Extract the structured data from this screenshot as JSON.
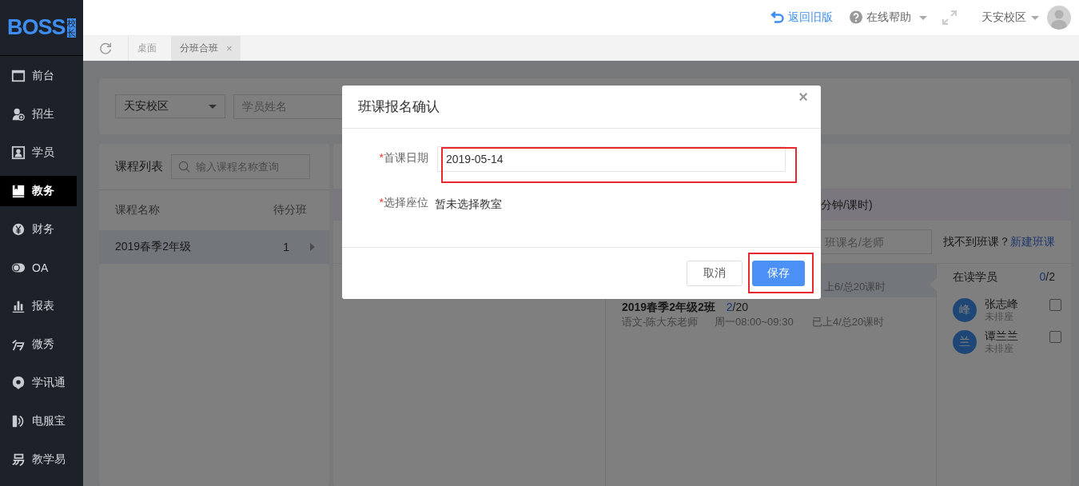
{
  "sidebar": {
    "logo": {
      "text": "BOSS",
      "badge": "校长"
    },
    "items": [
      {
        "label": "前台",
        "kind": "calendar",
        "selected": false
      },
      {
        "label": "招生",
        "kind": "user-add",
        "selected": false
      },
      {
        "label": "学员",
        "kind": "portrait",
        "selected": false
      },
      {
        "label": "教务",
        "kind": "book",
        "selected": true
      },
      {
        "label": "财务",
        "kind": "yen",
        "selected": false
      },
      {
        "label": "OA",
        "kind": "toggle",
        "selected": false
      },
      {
        "label": "报表",
        "kind": "chart",
        "selected": false
      },
      {
        "label": "微秀",
        "kind": "wave",
        "selected": false
      },
      {
        "label": "学讯通",
        "kind": "pin",
        "selected": false
      },
      {
        "label": "电服宝",
        "kind": "phone",
        "selected": false
      },
      {
        "label": "教学易",
        "kind": "steps",
        "selected": false
      }
    ]
  },
  "topbar": {
    "links": [
      {
        "kind": "back",
        "label": "返回旧版"
      },
      {
        "kind": "help",
        "label": "在线帮助"
      }
    ],
    "campus": "天安校区"
  },
  "tabs": [
    {
      "label": "桌面",
      "selected": false
    },
    {
      "label": "分班合班",
      "selected": true,
      "close": "×"
    }
  ],
  "filters": {
    "campus": "天安校区",
    "student_placeholder": "学员姓名"
  },
  "course_panel": {
    "title": "课程列表",
    "search_placeholder": "输入课程名称查询",
    "columns": [
      "课程名称",
      "待分班"
    ],
    "rows": [
      {
        "name": "2019春季2年级",
        "count": "1",
        "selected": true
      }
    ]
  },
  "class_panel": {
    "info_text": "分钟/课时)",
    "search_placeholder": "班课名/老师",
    "hint": "找不到班课？",
    "link": "新建班课",
    "classes": [
      {
        "selected": true,
        "progress": "上6/总20课时"
      },
      {
        "selected": false,
        "name": "2019春季2年级2班",
        "enrolled": "2",
        "capacity": "/20",
        "teacher": "语文-陈大东老师",
        "time": "周一08:00~09:30",
        "progress": "已上4/总20课时"
      }
    ]
  },
  "students_panel": {
    "title": "在读学员",
    "count": "0",
    "total": "/2",
    "students": [
      {
        "avatar": "峰",
        "name": "张志峰",
        "seat": "未排座",
        "checked": false
      },
      {
        "avatar": "兰",
        "name": "谭兰兰",
        "seat": "未排座",
        "checked": false
      }
    ]
  },
  "modal": {
    "title": "班课报名确认",
    "close": "×",
    "fields": [
      {
        "kind": "input",
        "required_mark": "*",
        "label": "首课日期",
        "value": "2019-05-14",
        "highlighted": true
      },
      {
        "kind": "text",
        "required_mark": "*",
        "label": "选择座位",
        "value": "暂未选择教室",
        "highlighted": false
      }
    ],
    "buttons": [
      {
        "kind": "secondary",
        "label": "取消",
        "highlighted": false
      },
      {
        "kind": "primary",
        "label": "保存",
        "highlighted": true
      }
    ]
  }
}
